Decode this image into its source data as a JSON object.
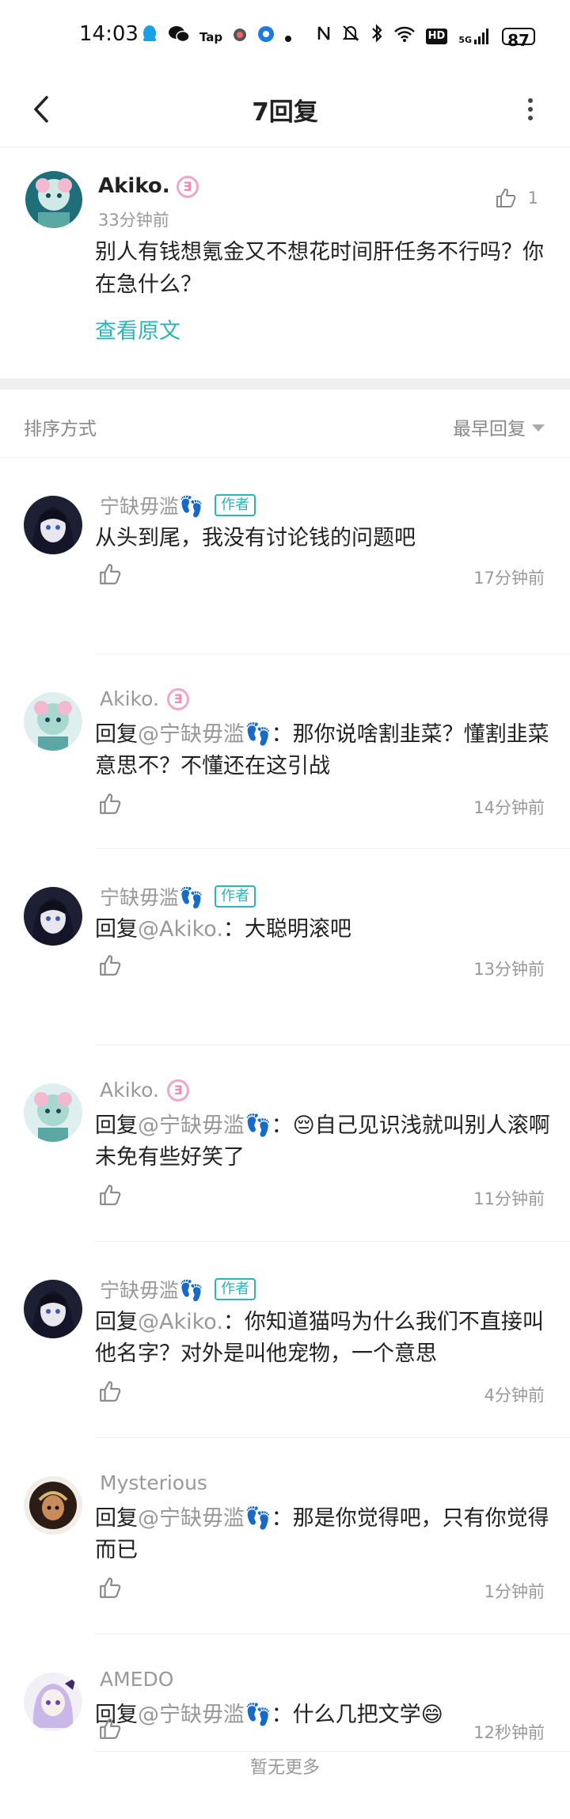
{
  "status_bar": {
    "time": "14:03",
    "left_icons": [
      "qq-icon",
      "wechat-icon",
      "tap-icon",
      "app-icon",
      "browser-icon",
      "dot-icon"
    ],
    "tap_label": "Tap",
    "right_icons": [
      "nfc-icon",
      "mute-icon",
      "bluetooth-icon",
      "wifi-icon",
      "hd-icon",
      "signal-icon"
    ],
    "hd_label": "HD",
    "signal_label": "5G",
    "battery": "87"
  },
  "app_bar": {
    "title": "7回复"
  },
  "original": {
    "name": "Akiko.",
    "time": "33分钟前",
    "like_count": "1",
    "text": "别人有钱想氪金又不想花时间肝任务不行吗？你在急什么？",
    "view_original": "查看原文"
  },
  "sort": {
    "label": "排序方式",
    "value": "最早回复"
  },
  "replies": [
    {
      "name": "宁缺毋滥👣",
      "is_author": true,
      "author_tag": "作者",
      "text": "从头到尾，我没有讨论钱的问题吧",
      "time": "17分钟前"
    },
    {
      "name": "Akiko.",
      "is_author": false,
      "reply_prefix": "回复",
      "mention": "@宁缺毋滥👣",
      "text": "：那你说啥割韭菜？懂割韭菜意思不？不懂还在这引战",
      "time": "14分钟前"
    },
    {
      "name": "宁缺毋滥👣",
      "is_author": true,
      "author_tag": "作者",
      "reply_prefix": "回复",
      "mention": "@Akiko.",
      "text": "：大聪明滚吧",
      "time": "13分钟前"
    },
    {
      "name": "Akiko.",
      "is_author": false,
      "reply_prefix": "回复",
      "mention": "@宁缺毋滥👣",
      "text": "：😔自己见识浅就叫别人滚啊 未免有些好笑了",
      "time": "11分钟前"
    },
    {
      "name": "宁缺毋滥👣",
      "is_author": true,
      "author_tag": "作者",
      "reply_prefix": "回复",
      "mention": "@Akiko.",
      "text": "：你知道猫吗为什么我们不直接叫他名字？对外是叫他宠物，一个意思",
      "time": "4分钟前"
    },
    {
      "name": "Mysterious",
      "is_author": false,
      "reply_prefix": "回复",
      "mention": "@宁缺毋滥👣",
      "text": "：那是你觉得吧，只有你觉得而已",
      "time": "1分钟前"
    },
    {
      "name": "AMEDO",
      "is_author": false,
      "reply_prefix": "回复",
      "mention": "@宁缺毋滥👣",
      "text": "：什么几把文学😄",
      "time": "12秒钟前"
    }
  ],
  "footer": {
    "no_more": "暂无更多"
  },
  "colors": {
    "accent": "#2db3b8",
    "muted": "#999999",
    "badge_pink": "#f08ab0"
  }
}
